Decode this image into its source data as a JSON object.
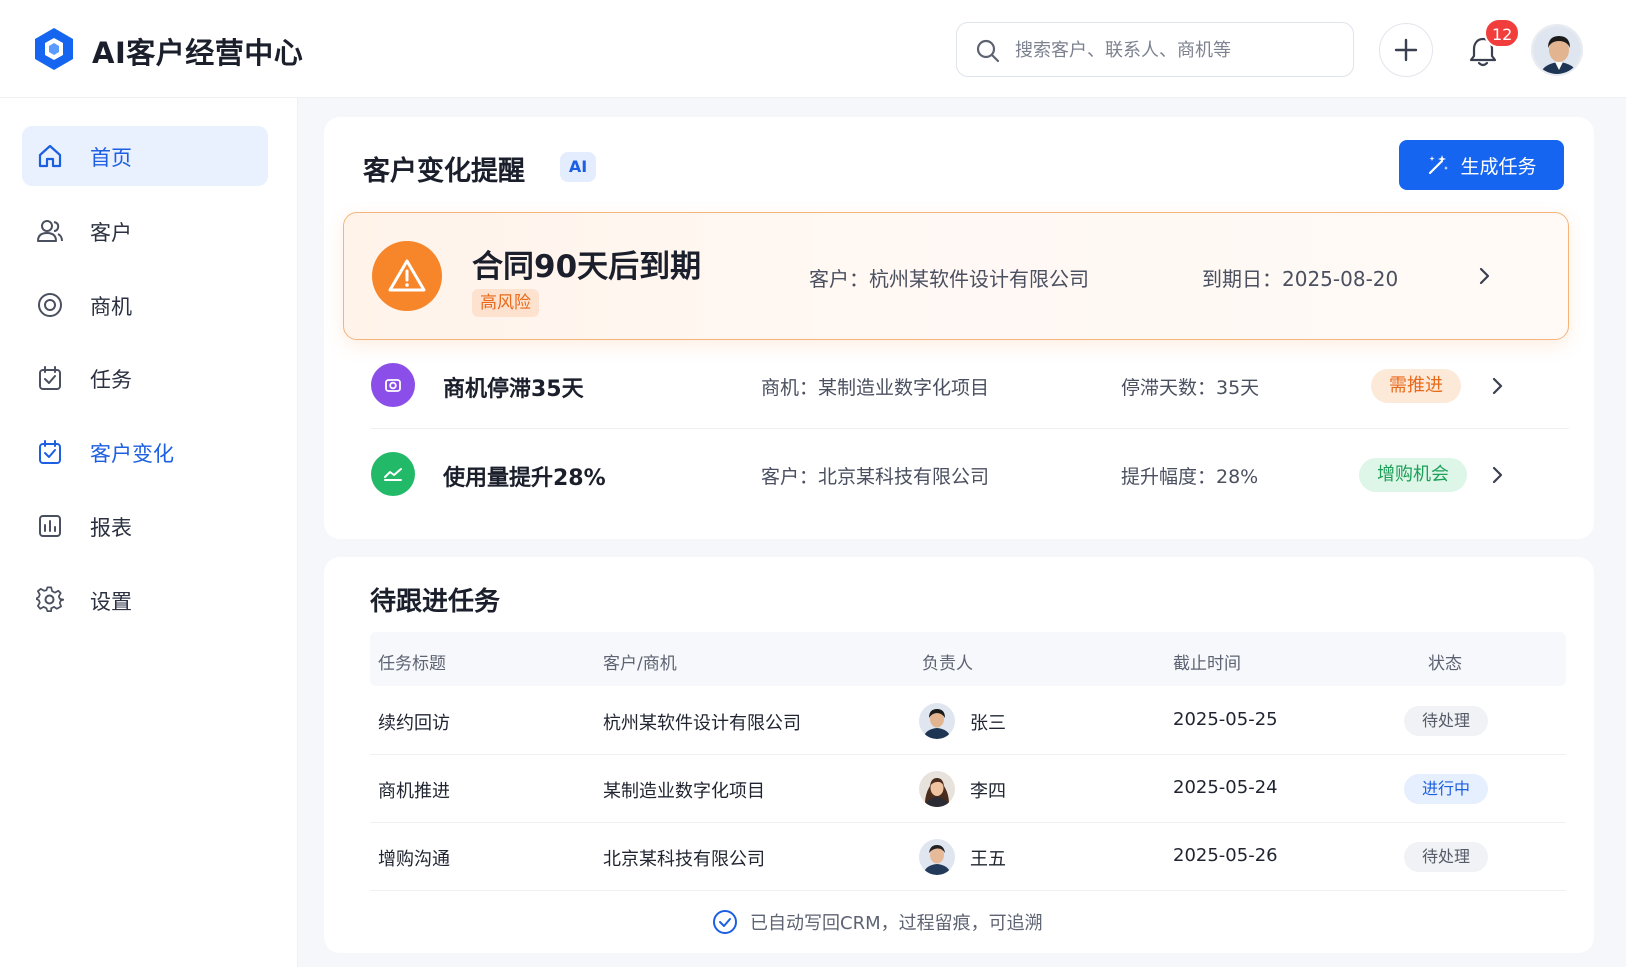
{
  "app": {
    "title": "AI客户经营中心"
  },
  "header": {
    "search_placeholder": "搜索客户、联系人、商机等",
    "notification_count": "12"
  },
  "sidebar": {
    "items": [
      {
        "label": "首页",
        "icon": "home-icon"
      },
      {
        "label": "客户",
        "icon": "users-icon"
      },
      {
        "label": "商机",
        "icon": "target-icon"
      },
      {
        "label": "任务",
        "icon": "task-icon"
      },
      {
        "label": "客户变化",
        "icon": "customer-change-icon"
      },
      {
        "label": "报表",
        "icon": "chart-icon"
      },
      {
        "label": "设置",
        "icon": "gear-icon"
      }
    ]
  },
  "alerts": {
    "title": "客户变化提醒",
    "ai_tag": "AI",
    "generate_button": "生成任务",
    "main": {
      "title": "合同90天后到期",
      "risk_tag": "高风险",
      "customer": "客户：杭州某软件设计有限公司",
      "due_date": "到期日：2025-08-20"
    },
    "rows": [
      {
        "title": "商机停滞35天",
        "detail": "商机：某制造业数字化项目",
        "metric": "停滞天数：35天",
        "tag": "需推进"
      },
      {
        "title": "使用量提升28%",
        "detail": "客户：北京某科技有限公司",
        "metric": "提升幅度：28%",
        "tag": "增购机会"
      }
    ]
  },
  "tasks": {
    "title": "待跟进任务",
    "columns": [
      "任务标题",
      "客户/商机",
      "负责人",
      "截止时间",
      "状态"
    ],
    "rows": [
      {
        "title": "续约回访",
        "target": "杭州某软件设计有限公司",
        "owner": "张三",
        "due": "2025-05-25",
        "status": "待处理"
      },
      {
        "title": "商机推进",
        "target": "某制造业数字化项目",
        "owner": "李四",
        "due": "2025-05-24",
        "status": "进行中"
      },
      {
        "title": "增购沟通",
        "target": "北京某科技有限公司",
        "owner": "王五",
        "due": "2025-05-26",
        "status": "待处理"
      }
    ],
    "footer_note": "已自动写回CRM，过程留痕，可追溯"
  },
  "colors": {
    "primary": "#1565f0",
    "warning": "#f7862b",
    "danger": "#f23d3d",
    "success": "#22b968",
    "purple": "#8b4ee8"
  }
}
